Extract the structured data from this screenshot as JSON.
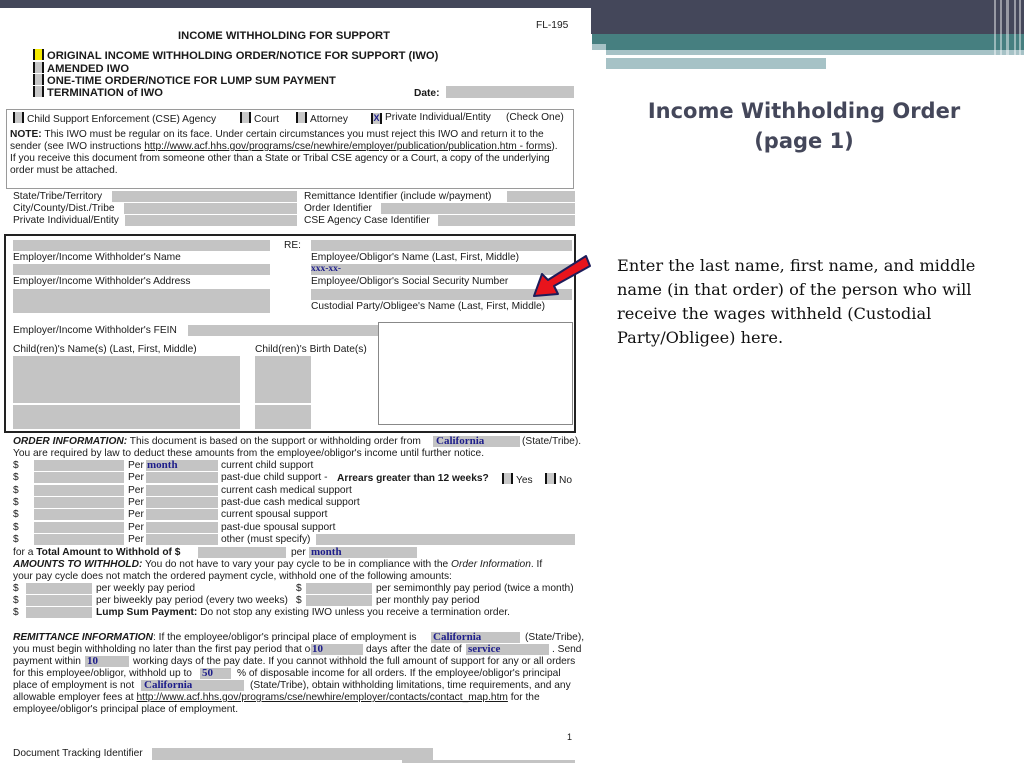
{
  "slide": {
    "title_line1": "Income Withholding Order",
    "title_line2": "(page 1)",
    "body": "Enter the last name, first name, and middle name (in that order) of the person who will receive the wages withheld (Custodial Party/Obligee) here.",
    "colors": {
      "header_dark": "#44475a",
      "header_teal": "#467f80",
      "header_light": "#a6c2c6",
      "arrow": "#e8141c"
    }
  },
  "form": {
    "form_number": "FL-195",
    "title": "INCOME WITHHOLDING FOR SUPPORT",
    "order_types": [
      {
        "label": "ORIGINAL INCOME WITHHOLDING ORDER/NOTICE FOR SUPPORT (IWO)",
        "highlighted": true,
        "checked": false
      },
      {
        "label": "AMENDED IWO",
        "checked": false
      },
      {
        "label": "ONE-TIME ORDER/NOTICE FOR LUMP SUM PAYMENT",
        "checked": false
      },
      {
        "label": "TERMINATION of IWO",
        "checked": false
      }
    ],
    "date_label": "Date:",
    "sender_types": [
      {
        "label": "Child Support Enforcement (CSE) Agency",
        "checked": false,
        "mark": ""
      },
      {
        "label": "Court",
        "checked": false,
        "mark": ""
      },
      {
        "label": "Attorney",
        "checked": false,
        "mark": ""
      },
      {
        "label": "Private Individual/Entity",
        "checked": true,
        "mark": "X"
      }
    ],
    "check_one": "(Check One)",
    "note": {
      "label": "NOTE:",
      "text1": " This IWO must be regular on its face. Under certain circumstances you must reject this IWO and return it to the",
      "text2_prefix": "sender (see IWO instructions ",
      "link": "http://www.acf.hhs.gov/programs/cse/newhire/employer/publication/publication.htm - forms",
      "text2_suffix": ").",
      "text3": "If you receive this document from someone other than a State or Tribal CSE agency or a Court, a copy of the underlying",
      "text4": "order must be attached."
    },
    "identifiers_left": [
      "State/Tribe/Territory",
      "City/County/Dist./Tribe",
      "Private Individual/Entity"
    ],
    "identifiers_right": [
      "Remittance Identifier (include w/payment)",
      "Order Identifier",
      "CSE Agency Case Identifier"
    ],
    "re_label": "RE:",
    "employer_name_label": "Employer/Income Withholder's Name",
    "employer_address_label": "Employer/Income Withholder's Address",
    "employee_name_label": "Employee/Obligor's Name (Last, First, Middle)",
    "ssn_value": "xxx-xx-",
    "ssn_label": "Employee/Obligor's Social Security Number",
    "custodial_label": "Custodial Party/Obligee's Name (Last, First, Middle)",
    "fein_label": "Employer/Income Withholder's FEIN",
    "children_names_label": "Child(ren)'s Name(s) (Last, First, Middle)",
    "children_dob_label": "Child(ren)'s Birth Date(s)",
    "order_info": {
      "label": "ORDER INFORMATION:",
      "text": " This document is based on the support or withholding order from ",
      "state": "California",
      "state_suffix": "(State/Tribe).",
      "line2": "You are required by law to deduct these amounts from the employee/obligor's income until further notice.",
      "rows": [
        {
          "dollar": "$",
          "per": "Per",
          "period": "month",
          "desc": "current child support"
        },
        {
          "dollar": "$",
          "per": "Per",
          "period": "",
          "desc": "past-due child support -"
        },
        {
          "dollar": "$",
          "per": "Per",
          "period": "",
          "desc": "current cash medical support"
        },
        {
          "dollar": "$",
          "per": "Per",
          "period": "",
          "desc": "past-due cash medical support"
        },
        {
          "dollar": "$",
          "per": "Per",
          "period": "",
          "desc": "current spousal support"
        },
        {
          "dollar": "$",
          "per": "Per",
          "period": "",
          "desc": "past-due spousal support"
        },
        {
          "dollar": "$",
          "per": "Per",
          "period": "",
          "desc": "other (must specify)"
        }
      ],
      "arrears_question": "Arrears greater than 12 weeks?",
      "yes_label": "Yes",
      "no_label": "No",
      "total_prefix": "for a ",
      "total_label": "Total Amount to Withhold",
      "total_of": " of $",
      "total_per": "per",
      "total_period": "month"
    },
    "amounts": {
      "label": "AMOUNTS TO WITHHOLD:",
      "text1": " You do not have to vary your pay cycle to be in compliance with the ",
      "text1_ital": "Order Information",
      "text1_end": ". If",
      "text2": "your pay cycle does not match the ordered payment cycle, withhold one of the following amounts:",
      "weekly": "per weekly pay period",
      "semimonthly": "per semimonthly pay period (twice a month)",
      "biweekly": "per biweekly pay period (every two weeks)",
      "monthly": "per monthly pay period",
      "lump_label": "Lump Sum Payment:",
      "lump_text": " Do not stop any existing IWO unless you receive a termination order.",
      "dollar": "$"
    },
    "remittance": {
      "label": "REMITTANCE INFORMATION",
      "t1": ": If the employee/obligor's principal place of employment is ",
      "state1": "California",
      "t1_end": "(State/Tribe),",
      "t2": "you must begin withholding no later than the first pay period that occur",
      "days1": "10",
      "t2b": "days after the date of ",
      "service": "service",
      "t2_end": ". Send",
      "t3": "payment within ",
      "days2": "10",
      "t3b": "working days of the pay date. If you cannot withhold the full amount of support for any or all orders",
      "t4": "for this employee/obligor, withhold up to ",
      "percent": "50",
      "t4b": "% of disposable income for all orders. If the employee/obligor's principal",
      "t5": "place of employment is not ",
      "state2": "California",
      "t5b": "(State/Tribe), obtain withholding limitations, time requirements, and any",
      "t6": "allowable employer fees at ",
      "link": "http://www.acf.hhs.gov/programs/cse/newhire/employer/contacts/contact_map.htm",
      "t6b": " for the",
      "t7": "employee/obligor's principal place of employment."
    },
    "page_number": "1",
    "tracking_label": "Document Tracking Identifier"
  }
}
